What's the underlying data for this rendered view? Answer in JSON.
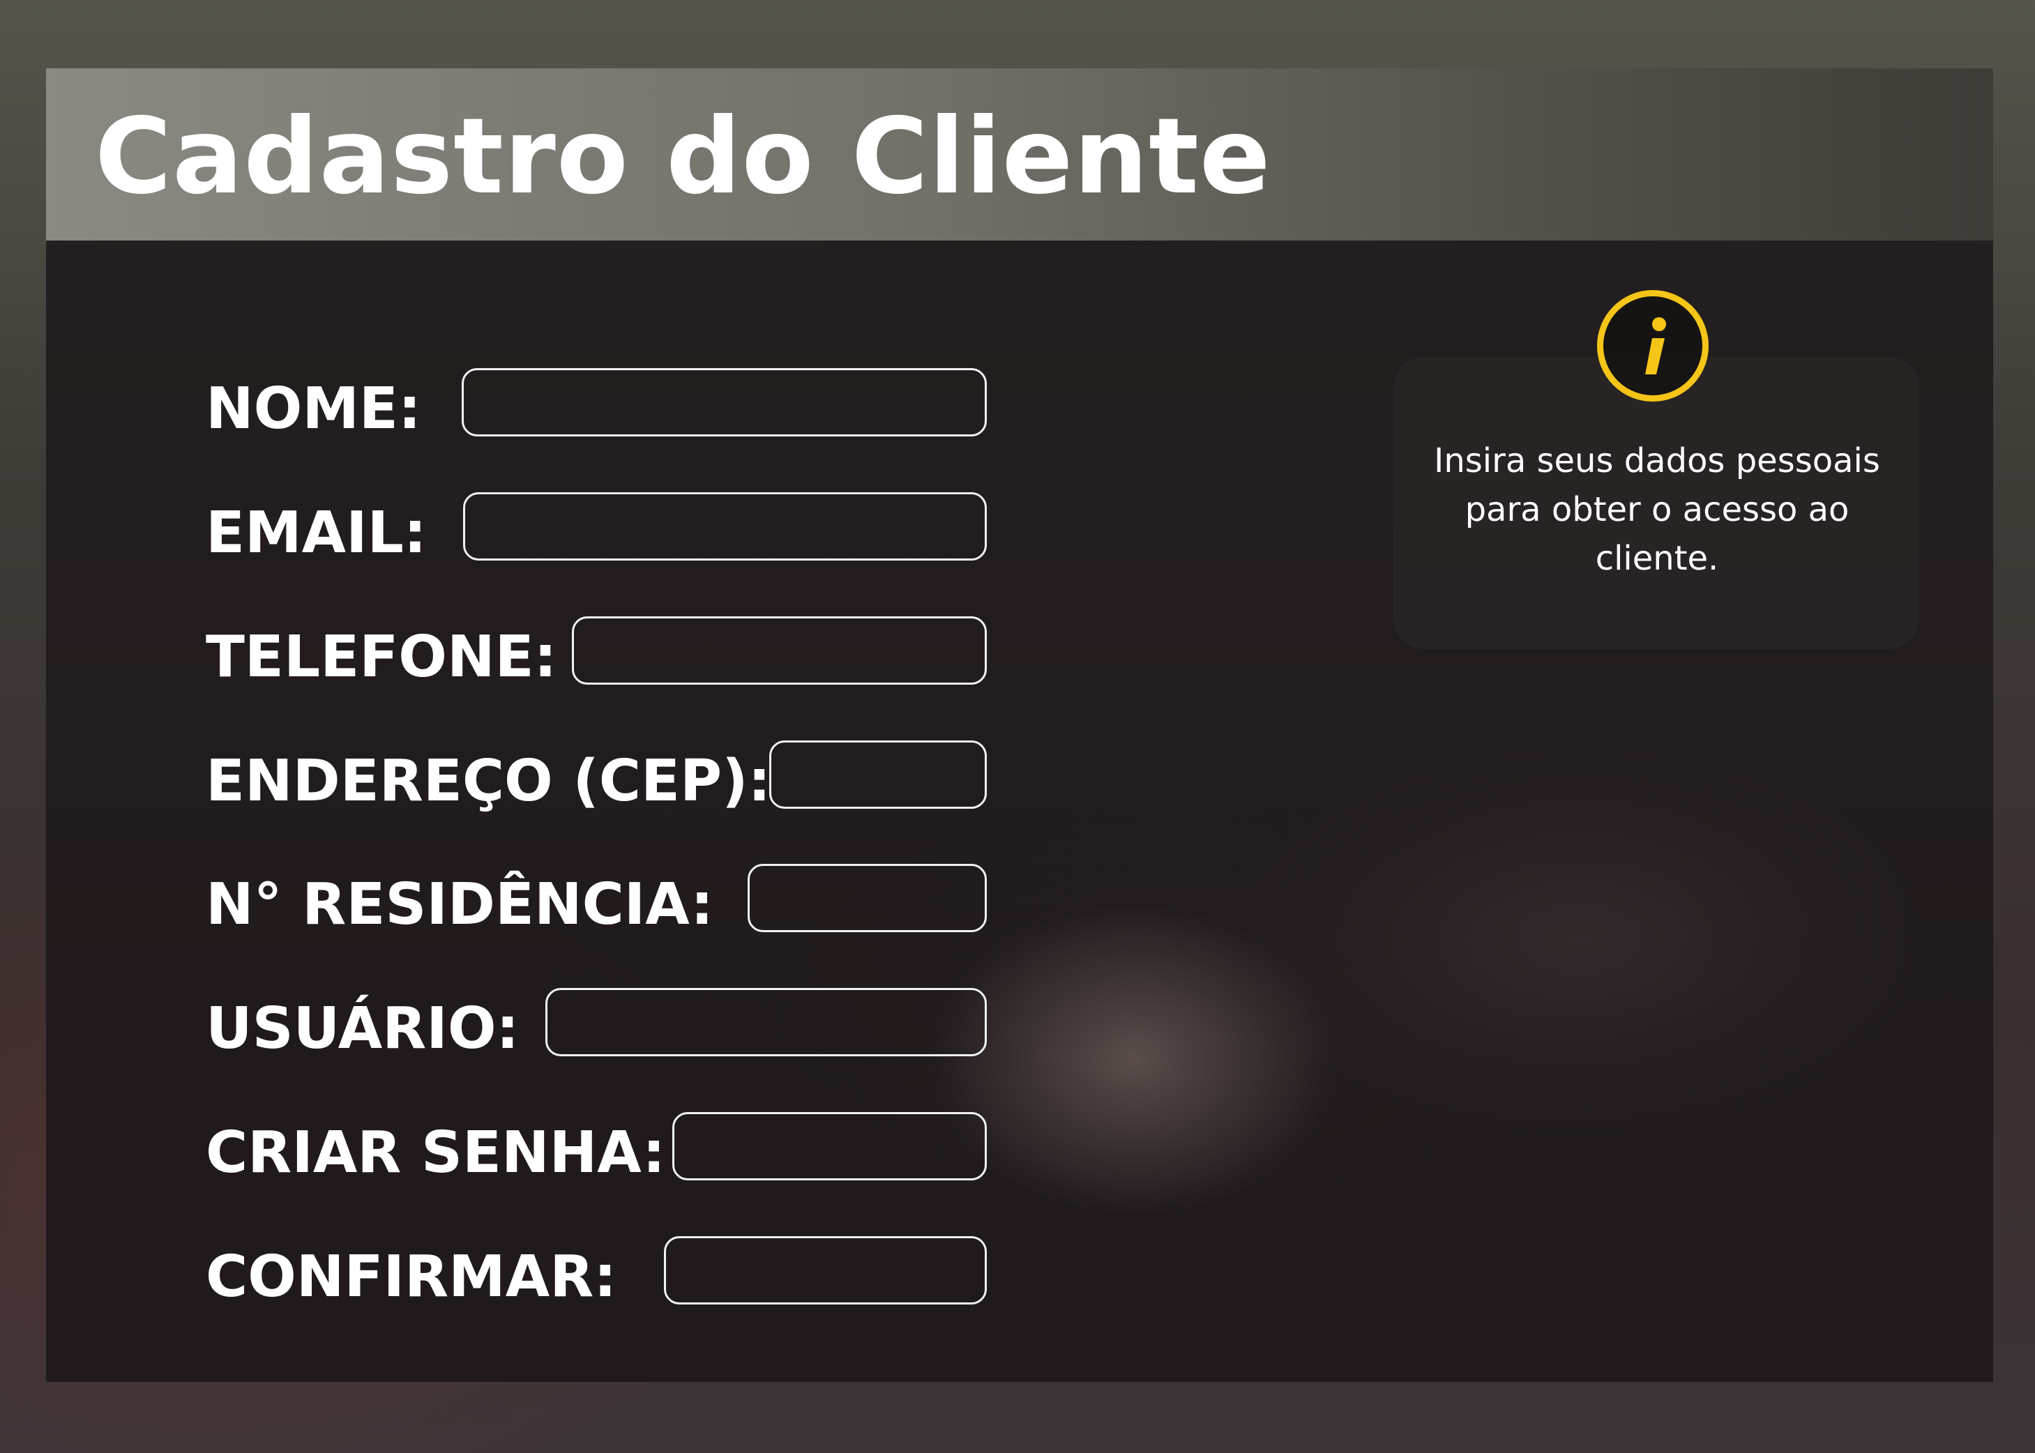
{
  "header": {
    "title": "Cadastro do Cliente"
  },
  "form": {
    "fields": [
      {
        "label": "NOME:",
        "value": "",
        "placeholder": ""
      },
      {
        "label": "EMAIL:",
        "value": "",
        "placeholder": ""
      },
      {
        "label": "TELEFONE:",
        "value": "",
        "placeholder": ""
      },
      {
        "label": "ENDEREÇO (CEP):",
        "value": "",
        "placeholder": ""
      },
      {
        "label": "N° RESIDÊNCIA:",
        "value": "",
        "placeholder": ""
      },
      {
        "label": "USUÁRIO:",
        "value": "",
        "placeholder": ""
      },
      {
        "label": "CRIAR SENHA:",
        "value": "",
        "placeholder": ""
      },
      {
        "label": "CONFIRMAR:",
        "value": "",
        "placeholder": ""
      }
    ]
  },
  "info": {
    "icon": "info-icon",
    "text": "Insira seus dados pessoais para obter o acesso ao cliente."
  },
  "colors": {
    "accent": "#f5c518",
    "text": "#ffffff",
    "input_border": "#f2f2f2"
  }
}
